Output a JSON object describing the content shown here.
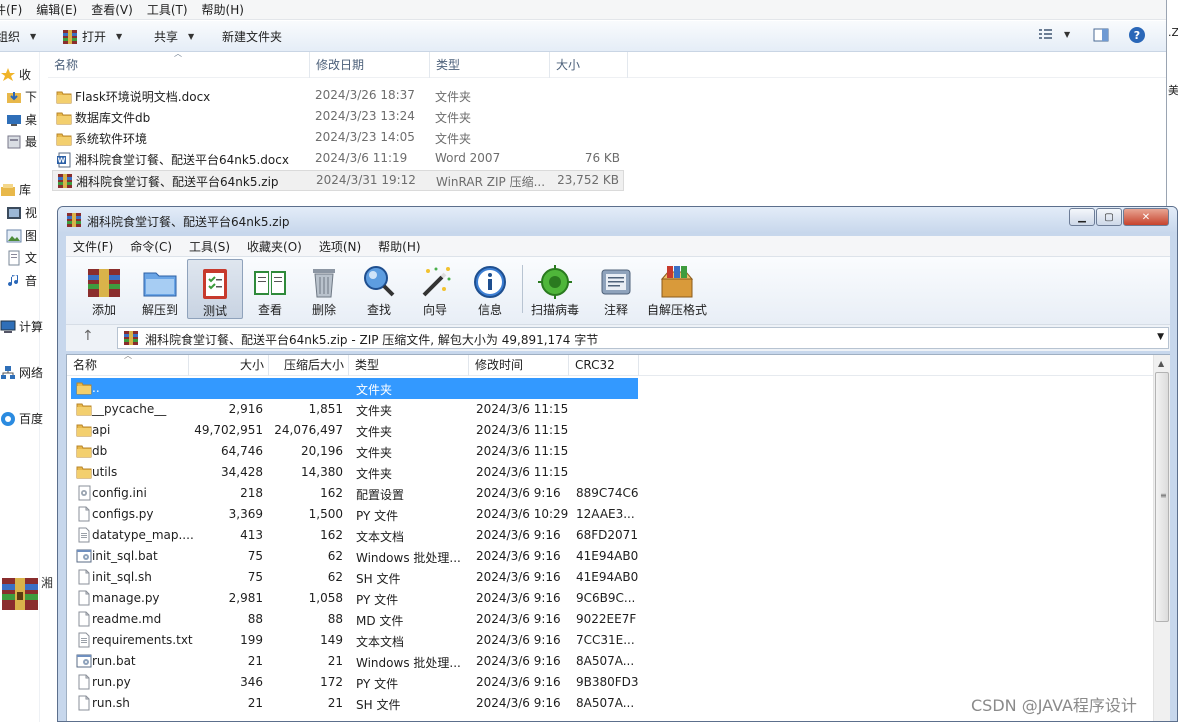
{
  "explorer": {
    "menu": [
      "件(F)",
      "编辑(E)",
      "查看(V)",
      "工具(T)",
      "帮助(H)"
    ],
    "toolbar": {
      "organize": "组织",
      "open": "打开",
      "share": "共享",
      "new_folder": "新建文件夹"
    },
    "columns": [
      "名称",
      "修改日期",
      "类型",
      "大小"
    ],
    "files": [
      {
        "name": "Flask环境说明文档.docx",
        "date": "2024/3/26 18:37",
        "type": "文件夹",
        "size": "",
        "icon": "folder-icon"
      },
      {
        "name": "数据库文件db",
        "date": "2024/3/23 13:24",
        "type": "文件夹",
        "size": "",
        "icon": "folder-icon"
      },
      {
        "name": "系统软件环境",
        "date": "2024/3/23 14:05",
        "type": "文件夹",
        "size": "",
        "icon": "folder-icon"
      },
      {
        "name": "湘科院食堂订餐、配送平台64nk5.docx",
        "date": "2024/3/6 11:19",
        "type": "Word 2007",
        "size": "76 KB",
        "icon": "word-doc-icon"
      },
      {
        "name": "湘科院食堂订餐、配送平台64nk5.zip",
        "date": "2024/3/31 19:12",
        "type": "WinRAR ZIP 压缩...",
        "size": "23,752 KB",
        "icon": "winrar-zip-icon"
      }
    ],
    "nav": [
      "收",
      "下",
      "桌",
      "最",
      "库",
      "视",
      "图",
      "文",
      "音",
      "计算",
      "网络",
      "百度"
    ],
    "right_edge": [
      ".Z",
      "美"
    ]
  },
  "winrar": {
    "title": "湘科院食堂订餐、配送平台64nk5.zip",
    "menu": [
      "文件(F)",
      "命令(C)",
      "工具(S)",
      "收藏夹(O)",
      "选项(N)",
      "帮助(H)"
    ],
    "tools": [
      "添加",
      "解压到",
      "测试",
      "查看",
      "删除",
      "查找",
      "向导",
      "信息",
      "扫描病毒",
      "注释",
      "自解压格式"
    ],
    "path": "湘科院食堂订餐、配送平台64nk5.zip - ZIP 压缩文件, 解包大小为 49,891,174 字节",
    "columns": [
      "名称",
      "大小",
      "压缩后大小",
      "类型",
      "修改时间",
      "CRC32"
    ],
    "rows": [
      {
        "name": "..",
        "size": "",
        "packed": "",
        "type": "文件夹",
        "mtime": "",
        "crc": "",
        "icon": "folder-up-icon"
      },
      {
        "name": "__pycache__",
        "size": "2,916",
        "packed": "1,851",
        "type": "文件夹",
        "mtime": "2024/3/6 11:15",
        "crc": "",
        "icon": "folder-icon"
      },
      {
        "name": "api",
        "size": "49,702,951",
        "packed": "24,076,497",
        "type": "文件夹",
        "mtime": "2024/3/6 11:15",
        "crc": "",
        "icon": "folder-icon"
      },
      {
        "name": "db",
        "size": "64,746",
        "packed": "20,196",
        "type": "文件夹",
        "mtime": "2024/3/6 11:15",
        "crc": "",
        "icon": "folder-icon"
      },
      {
        "name": "utils",
        "size": "34,428",
        "packed": "14,380",
        "type": "文件夹",
        "mtime": "2024/3/6 11:15",
        "crc": "",
        "icon": "folder-icon"
      },
      {
        "name": "config.ini",
        "size": "218",
        "packed": "162",
        "type": "配置设置",
        "mtime": "2024/3/6 9:16",
        "crc": "889C74C6",
        "icon": "config-file-icon"
      },
      {
        "name": "configs.py",
        "size": "3,369",
        "packed": "1,500",
        "type": "PY 文件",
        "mtime": "2024/3/6 10:29",
        "crc": "12AAE3...",
        "icon": "file-icon"
      },
      {
        "name": "datatype_map....",
        "size": "413",
        "packed": "162",
        "type": "文本文档",
        "mtime": "2024/3/6 9:16",
        "crc": "68FD2071",
        "icon": "text-file-icon"
      },
      {
        "name": "init_sql.bat",
        "size": "75",
        "packed": "62",
        "type": "Windows 批处理...",
        "mtime": "2024/3/6 9:16",
        "crc": "41E94AB0",
        "icon": "batch-file-icon"
      },
      {
        "name": "init_sql.sh",
        "size": "75",
        "packed": "62",
        "type": "SH 文件",
        "mtime": "2024/3/6 9:16",
        "crc": "41E94AB0",
        "icon": "file-icon"
      },
      {
        "name": "manage.py",
        "size": "2,981",
        "packed": "1,058",
        "type": "PY 文件",
        "mtime": "2024/3/6 9:16",
        "crc": "9C6B9C...",
        "icon": "file-icon"
      },
      {
        "name": "readme.md",
        "size": "88",
        "packed": "88",
        "type": "MD 文件",
        "mtime": "2024/3/6 9:16",
        "crc": "9022EE7F",
        "icon": "file-icon"
      },
      {
        "name": "requirements.txt",
        "size": "199",
        "packed": "149",
        "type": "文本文档",
        "mtime": "2024/3/6 9:16",
        "crc": "7CC31E...",
        "icon": "text-file-icon"
      },
      {
        "name": "run.bat",
        "size": "21",
        "packed": "21",
        "type": "Windows 批处理...",
        "mtime": "2024/3/6 9:16",
        "crc": "8A507A...",
        "icon": "batch-file-icon"
      },
      {
        "name": "run.py",
        "size": "346",
        "packed": "172",
        "type": "PY 文件",
        "mtime": "2024/3/6 9:16",
        "crc": "9B380FD3",
        "icon": "file-icon"
      },
      {
        "name": "run.sh",
        "size": "21",
        "packed": "21",
        "type": "SH 文件",
        "mtime": "2024/3/6 9:16",
        "crc": "8A507A...",
        "icon": "file-icon"
      }
    ]
  },
  "dock_label": "湘",
  "watermark": "CSDN @JAVA程序设计",
  "colors": {
    "selection": "#3399ff",
    "folder": "#e8b84a",
    "title_bar": "#c7d7ec",
    "close_button": "#c7432d"
  }
}
